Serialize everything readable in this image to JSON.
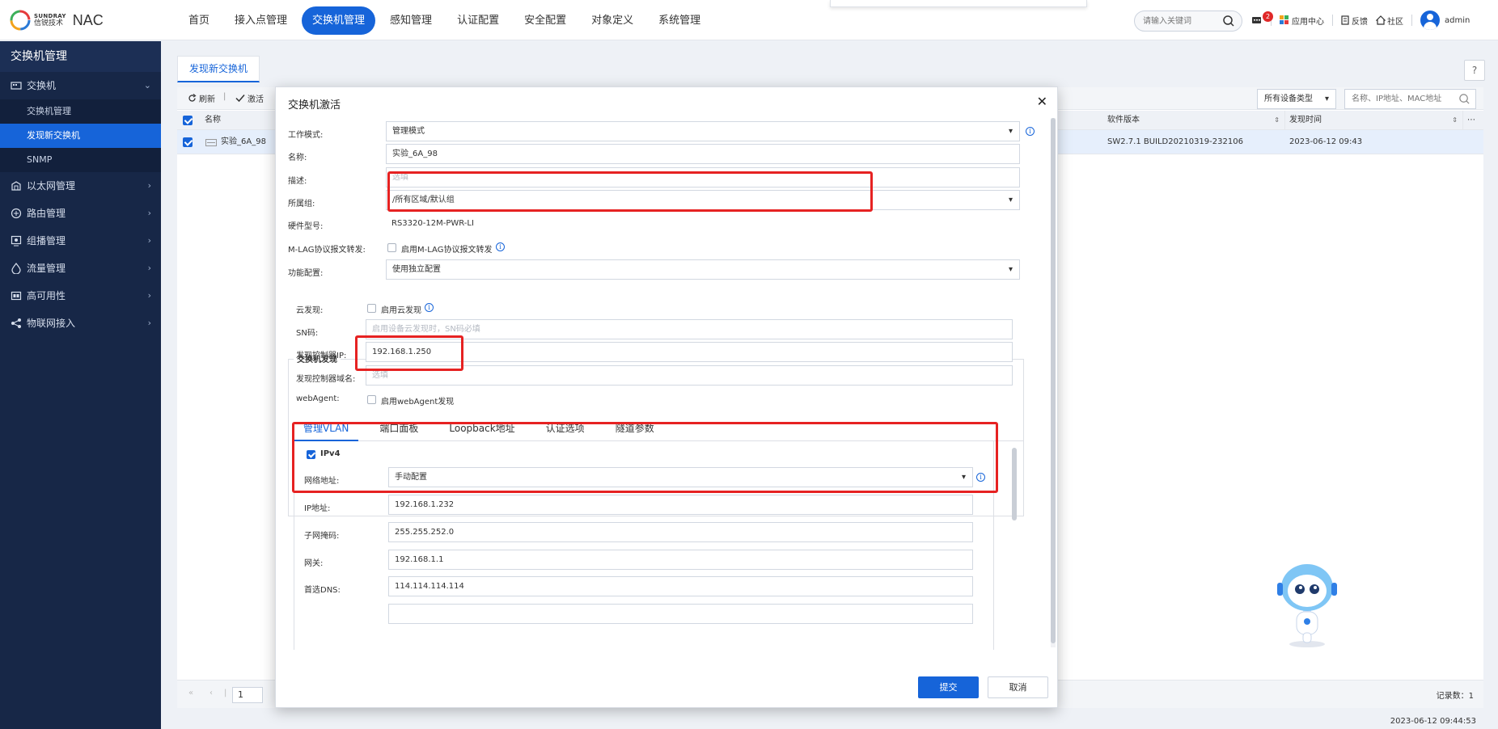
{
  "brand": {
    "company_en": "SUNDRAY",
    "company_cn": "信锐技术",
    "product": "NAC"
  },
  "topnav": [
    {
      "label": "首页",
      "active": false
    },
    {
      "label": "接入点管理",
      "active": false
    },
    {
      "label": "交换机管理",
      "active": true
    },
    {
      "label": "感知管理",
      "active": false
    },
    {
      "label": "认证配置",
      "active": false
    },
    {
      "label": "安全配置",
      "active": false
    },
    {
      "label": "对象定义",
      "active": false
    },
    {
      "label": "系统管理",
      "active": false
    }
  ],
  "top_search": {
    "placeholder": "请输入关键词"
  },
  "top_right": {
    "msg_count": "2",
    "app_center": "应用中心",
    "feedback": "反馈",
    "community": "社区",
    "user": "admin"
  },
  "sidebar": {
    "title": "交换机管理",
    "groups": [
      {
        "label": "交换机",
        "icon": "switch-icon",
        "expanded": true,
        "items": [
          {
            "label": "交换机管理",
            "active": false
          },
          {
            "label": "发现新交换机",
            "active": true
          },
          {
            "label": "SNMP",
            "active": false
          }
        ]
      },
      {
        "label": "以太网管理",
        "icon": "ethernet-icon"
      },
      {
        "label": "路由管理",
        "icon": "route-icon"
      },
      {
        "label": "组播管理",
        "icon": "multicast-icon"
      },
      {
        "label": "流量管理",
        "icon": "traffic-icon"
      },
      {
        "label": "高可用性",
        "icon": "ha-icon"
      },
      {
        "label": "物联网接入",
        "icon": "iot-icon"
      }
    ]
  },
  "main": {
    "tab": "发现新交换机",
    "toolbar": {
      "refresh": "刷新",
      "activate": "激活"
    },
    "device_type": "所有设备类型",
    "list_search_placeholder": "名称、IP地址、MAC地址",
    "columns": {
      "name": "名称",
      "software_version": "软件版本",
      "discover_time": "发现时间"
    },
    "rows": [
      {
        "name": "实验_6A_98",
        "software_version": "SW2.7.1 BUILD20210319-232106",
        "discover_time": "2023-06-12 09:43",
        "checked": true
      }
    ],
    "pager": {
      "page": "1",
      "record_count": "记录数：1"
    },
    "footer_time": "2023-06-12 09:44:53"
  },
  "modal": {
    "title": "交换机激活",
    "fields": {
      "work_mode": {
        "label": "工作模式:",
        "value": "管理模式"
      },
      "name": {
        "label": "名称:",
        "value": "实验_6A_98"
      },
      "description": {
        "label": "描述:",
        "placeholder": "选填"
      },
      "group": {
        "label": "所属组:",
        "value": "/所有区域/默认组"
      },
      "hw_model": {
        "label": "硬件型号:",
        "value": "RS3320-12M-PWR-LI"
      },
      "mlag": {
        "label": "M-LAG协议报文转发:",
        "checkbox_label": "启用M-LAG协议报文转发"
      },
      "func_config": {
        "label": "功能配置:",
        "value": "使用独立配置"
      }
    },
    "discovery": {
      "legend": "交换机发现",
      "cloud": {
        "label": "云发现:",
        "checkbox_label": "启用云发现"
      },
      "sn": {
        "label": "SN码:",
        "placeholder": "启用设备云发现时，SN码必填"
      },
      "controller_ip": {
        "label": "发现控制器IP:",
        "value": "192.168.1.250"
      },
      "controller_domain": {
        "label": "发现控制器域名:",
        "placeholder": "选填"
      },
      "webagent": {
        "label": "webAgent:",
        "checkbox_label": "启用webAgent发现"
      }
    },
    "tabs": [
      {
        "label": "管理VLAN",
        "active": true
      },
      {
        "label": "端口面板",
        "active": false
      },
      {
        "label": "Loopback地址",
        "active": false
      },
      {
        "label": "认证选项",
        "active": false
      },
      {
        "label": "隧道参数",
        "active": false
      }
    ],
    "vlan": {
      "ipv4_label": "IPv4",
      "net_addr": {
        "label": "网络地址:",
        "value": "手动配置"
      },
      "ip": {
        "label": "IP地址:",
        "value": "192.168.1.232"
      },
      "mask": {
        "label": "子网掩码:",
        "value": "255.255.252.0"
      },
      "gateway": {
        "label": "网关:",
        "value": "192.168.1.1"
      },
      "dns": {
        "label": "首选DNS:",
        "value": "114.114.114.114"
      }
    },
    "buttons": {
      "submit": "提交",
      "cancel": "取消"
    }
  },
  "colors": {
    "primary": "#1664d9",
    "sidebar": "#172747",
    "highlight": "#e62222"
  }
}
